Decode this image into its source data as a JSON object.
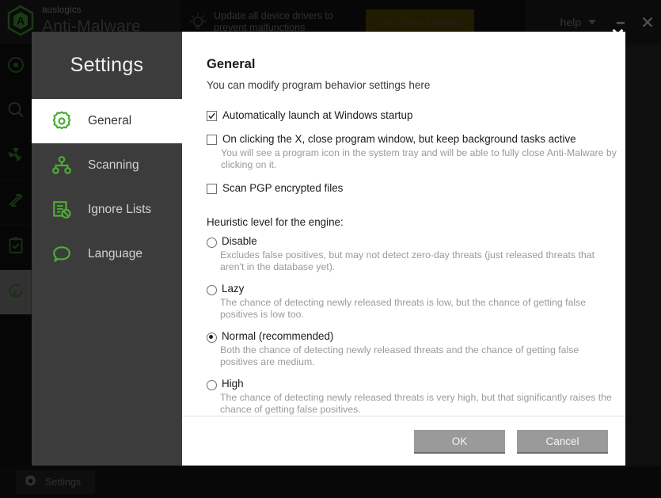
{
  "app": {
    "brand_sub": "auslogics",
    "brand_title": "Anti-Malware",
    "promo_text": "Update all device drivers to prevent malfunctions",
    "promo_button": "Get Driver Updater",
    "help_label": "help",
    "status_label": "Settings",
    "rail": [
      {
        "icon": "target-icon",
        "name": "rail-item-overview",
        "active": false
      },
      {
        "icon": "magnifier-icon",
        "name": "rail-item-scan",
        "active": false
      },
      {
        "icon": "radiation-icon",
        "name": "rail-item-threats",
        "active": false
      },
      {
        "icon": "arrows-icon",
        "name": "rail-item-activity",
        "active": false
      },
      {
        "icon": "clipboard-check-icon",
        "name": "rail-item-reports",
        "active": false
      },
      {
        "icon": "refresh-icon",
        "name": "rail-item-update",
        "active": true
      }
    ],
    "window_controls": {
      "minimize": "minimize-icon",
      "close": "close-icon"
    }
  },
  "dialog": {
    "close_icon": "close-icon",
    "nav": {
      "title": "Settings",
      "items": [
        {
          "label": "General",
          "icon": "gear-icon",
          "active": true
        },
        {
          "label": "Scanning",
          "icon": "network-nodes-icon",
          "active": false
        },
        {
          "label": "Ignore Lists",
          "icon": "list-block-icon",
          "active": false
        },
        {
          "label": "Language",
          "icon": "speech-bubble-icon",
          "active": false
        }
      ]
    },
    "panel": {
      "title": "General",
      "subtitle": "You can modify program behavior settings here",
      "checkboxes": [
        {
          "label": "Automatically launch at Windows startup",
          "checked": true,
          "hint": ""
        },
        {
          "label": "On clicking the X, close program window, but keep background tasks active",
          "checked": false,
          "hint": "You will see a program icon in the system tray and will be able to fully close Anti-Malware by clicking on it."
        },
        {
          "label": "Scan PGP encrypted files",
          "checked": false,
          "hint": ""
        }
      ],
      "heuristic_title": "Heuristic level for the engine:",
      "heuristic_options": [
        {
          "label": "Disable",
          "selected": false,
          "hint": "Excludes false positives, but may not detect zero-day threats (just released threats that aren't in the database yet)."
        },
        {
          "label": "Lazy",
          "selected": false,
          "hint": "The chance of detecting newly released threats is low, but the chance of getting false positives is low too."
        },
        {
          "label": "Normal (recommended)",
          "selected": true,
          "hint": "Both the chance of detecting newly released threats and the chance of getting false positives are medium."
        },
        {
          "label": "High",
          "selected": false,
          "hint": "The chance of detecting newly released threats is very high, but that significantly raises the chance of getting false positives."
        }
      ],
      "ok_label": "OK",
      "cancel_label": "Cancel"
    }
  },
  "colors": {
    "accent_green": "#4caf32",
    "dialog_nav_bg": "#3c3c3c",
    "promo_amber": "#3d3205",
    "button_gray": "#9a9a9a"
  }
}
